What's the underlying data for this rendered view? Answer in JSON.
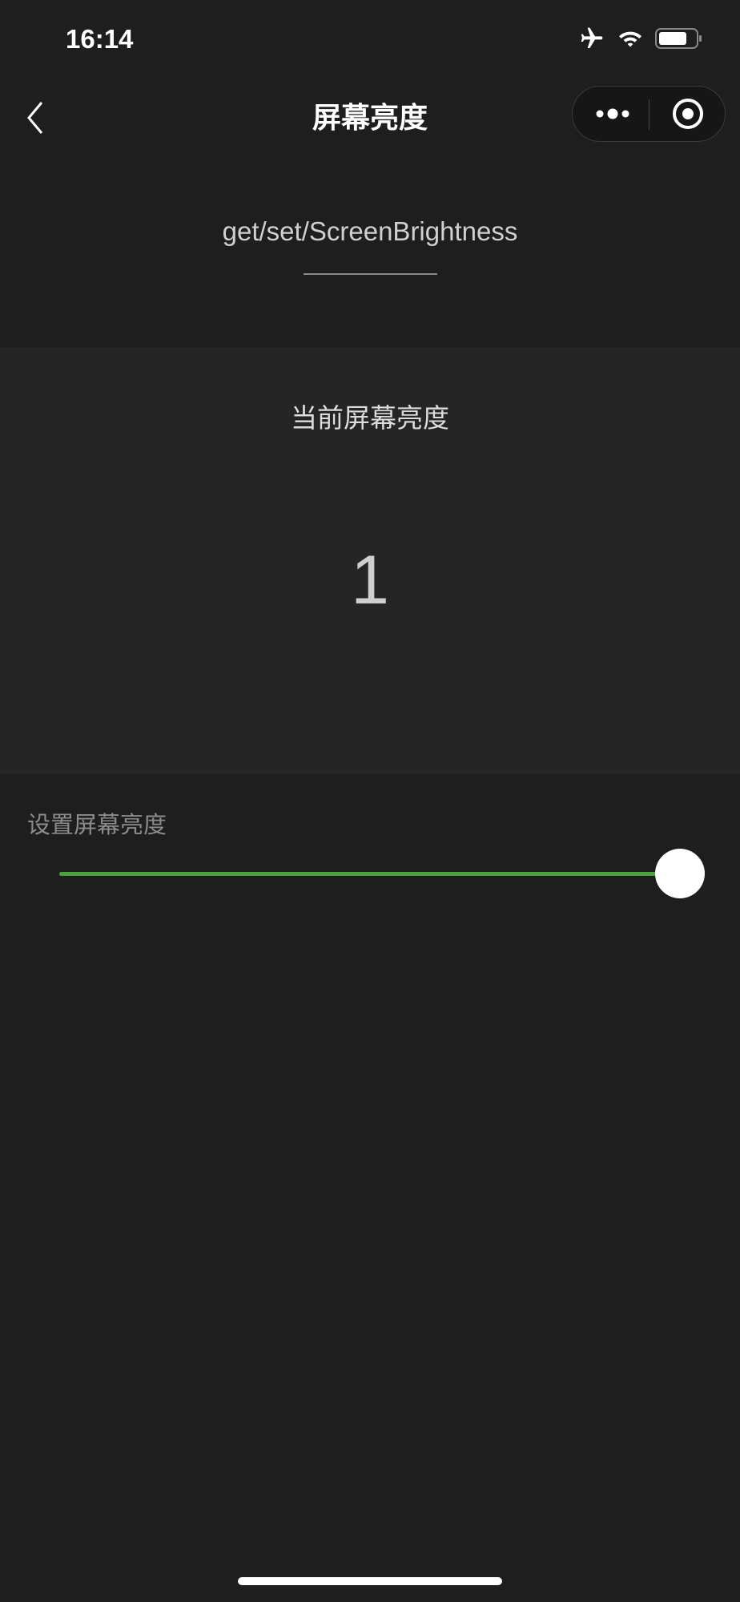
{
  "status_bar": {
    "time": "16:14",
    "icons": [
      "airplane-icon",
      "wifi-icon",
      "battery-icon"
    ]
  },
  "nav": {
    "title": "屏幕亮度",
    "back_icon": "chevron-left-icon",
    "more_icon": "more-dots-icon",
    "close_icon": "target-circle-icon"
  },
  "main": {
    "api_name": "get/set/ScreenBrightness",
    "current_label": "当前屏幕亮度",
    "current_value": "1",
    "set_label": "设置屏幕亮度",
    "slider": {
      "value": 1,
      "min": 0,
      "max": 1,
      "active_color": "#4aa23a"
    }
  }
}
